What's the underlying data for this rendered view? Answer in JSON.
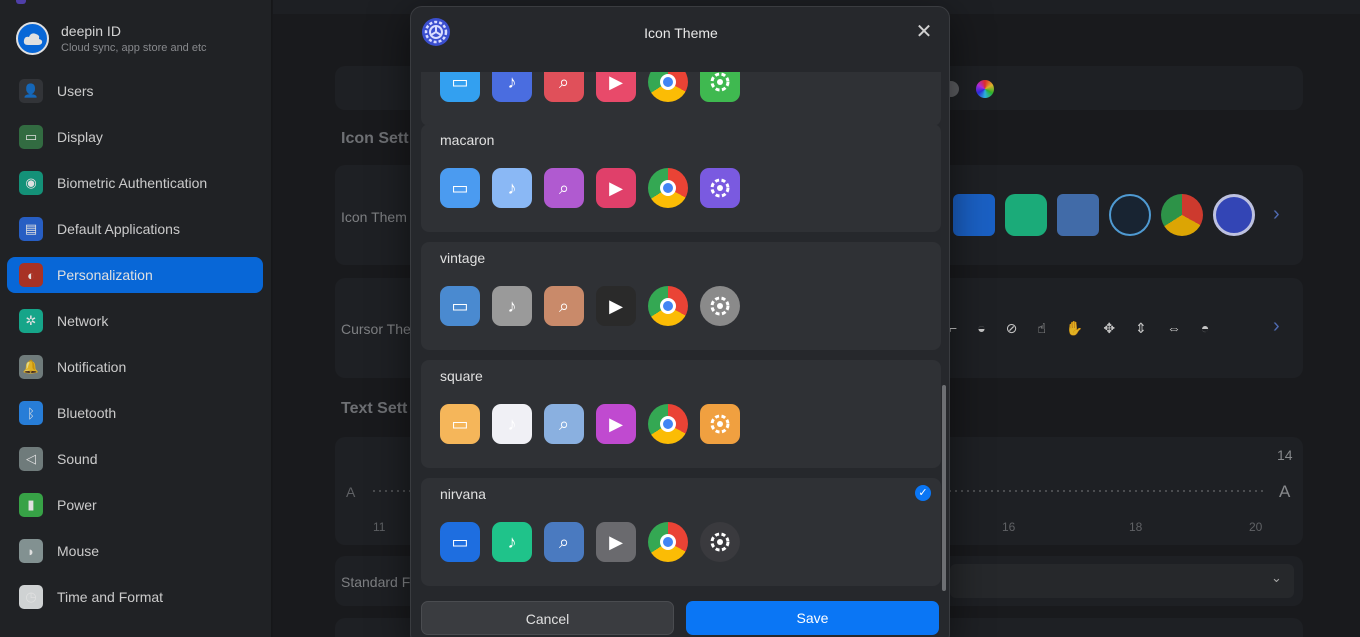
{
  "deepin_id": {
    "title": "deepin ID",
    "subtitle": "Cloud sync, app store and etc"
  },
  "nav": [
    {
      "label": "Users",
      "icon": "user-icon",
      "color": "#3a3c40"
    },
    {
      "label": "Display",
      "icon": "display-icon",
      "color": "#3a7a4a"
    },
    {
      "label": "Biometric Authentication",
      "icon": "fingerprint-icon",
      "color": "#17a589"
    },
    {
      "label": "Default Applications",
      "icon": "default-apps-icon",
      "color": "#2d6cdf"
    },
    {
      "label": "Personalization",
      "icon": "personalization-icon",
      "color": "#c0392b",
      "active": true
    },
    {
      "label": "Network",
      "icon": "network-icon",
      "color": "#1abc9c"
    },
    {
      "label": "Notification",
      "icon": "bell-icon",
      "color": "#7f8c8d"
    },
    {
      "label": "Bluetooth",
      "icon": "bluetooth-icon",
      "color": "#2d8ff5"
    },
    {
      "label": "Sound",
      "icon": "speaker-icon",
      "color": "#7f8c8d"
    },
    {
      "label": "Power",
      "icon": "battery-icon",
      "color": "#3fb950"
    },
    {
      "label": "Mouse",
      "icon": "mouse-icon",
      "color": "#95a5a6"
    },
    {
      "label": "Time and Format",
      "icon": "clock-icon",
      "color": "#ecf0f1"
    }
  ],
  "background": {
    "icon_settings": "Icon Sett",
    "icon_theme": "Icon Them",
    "cursor_theme": "Cursor The",
    "text_settings": "Text Sett",
    "standard_font": "Standard F",
    "slider_min": "A",
    "slider_max": "A",
    "slider_value": "14",
    "tick_11": "11",
    "tick_16": "16",
    "tick_18": "18",
    "tick_20": "20"
  },
  "dialog": {
    "title": "Icon Theme",
    "themes": [
      {
        "name": "",
        "icons": [
          "#33a0f0",
          "#4a6de0",
          "#e0505a",
          "#e84a6a",
          "#f0c030",
          "#3fb950"
        ]
      },
      {
        "name": "macaron",
        "icons": [
          "#4b9bf0",
          "#8ab8f5",
          "#b05ad0",
          "#e0406a",
          "#f0c030",
          "#7a5ae0"
        ]
      },
      {
        "name": "vintage",
        "icons": [
          "#4a8ad0",
          "#9a9a9a",
          "#c98a6a",
          "#2a2a2a",
          "#f0c030",
          "#8a8a8a"
        ]
      },
      {
        "name": "square",
        "icons": [
          "#f5b65a",
          "#f0f0f5",
          "#8ab0e0",
          "#c04ad0",
          "#f0c030",
          "#f0a040"
        ]
      },
      {
        "name": "nirvana",
        "icons": [
          "#1e6ee0",
          "#1fc38a",
          "#4a7ac0",
          "#6a6a6e",
          "#f0c030",
          "#3a3a3e"
        ],
        "selected": true
      }
    ],
    "cancel": "Cancel",
    "save": "Save"
  }
}
